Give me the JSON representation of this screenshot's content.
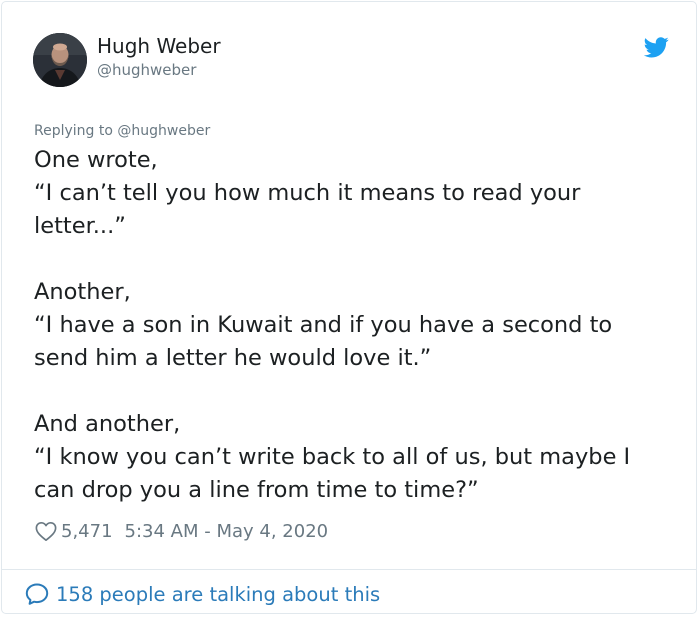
{
  "author": {
    "name": "Hugh Weber",
    "handle": "@hughweber"
  },
  "reply_context": "Replying to @hughweber",
  "tweet": {
    "paragraphs": [
      [
        "One wrote,",
        "“I can’t tell you how much it means to read your",
        "letter...”"
      ],
      [
        "Another,",
        "“I have a son in Kuwait and if you have a second to",
        "send him a letter he would love it.”"
      ],
      [
        "And another,",
        "“I know you can’t write back to all of us, but maybe I",
        "can drop you a line from time to time?”"
      ]
    ]
  },
  "meta": {
    "likes": "5,471",
    "timestamp": "5:34 AM - May 4, 2020"
  },
  "footer": {
    "conversation_label": "158 people are talking about this"
  },
  "colors": {
    "twitter_blue": "#1da1f2",
    "link_blue": "#2b7bb9",
    "secondary_text": "#697882",
    "border": "#e1e8ed"
  },
  "icons": {
    "logo": "twitter-bird-icon",
    "like": "heart-outline-icon",
    "conversation": "speech-bubble-icon"
  }
}
